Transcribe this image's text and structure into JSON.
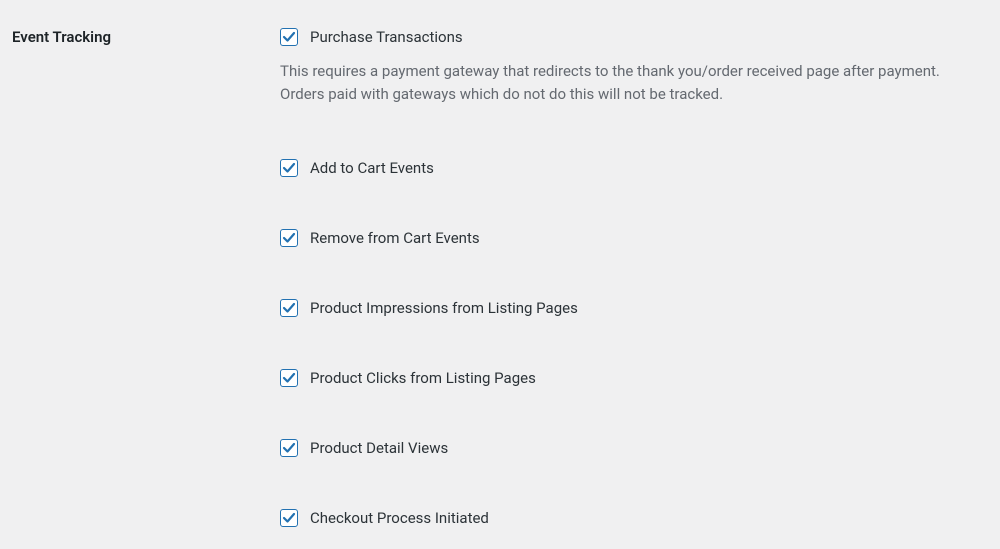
{
  "section": {
    "title": "Event Tracking"
  },
  "options": [
    {
      "key": "purchase-transactions",
      "label": "Purchase Transactions",
      "checked": true,
      "description": "This requires a payment gateway that redirects to the thank you/order received page after payment. Orders paid with gateways which do not do this will not be tracked."
    },
    {
      "key": "add-to-cart",
      "label": "Add to Cart Events",
      "checked": true
    },
    {
      "key": "remove-from-cart",
      "label": "Remove from Cart Events",
      "checked": true
    },
    {
      "key": "product-impressions",
      "label": "Product Impressions from Listing Pages",
      "checked": true
    },
    {
      "key": "product-clicks",
      "label": "Product Clicks from Listing Pages",
      "checked": true
    },
    {
      "key": "product-detail-views",
      "label": "Product Detail Views",
      "checked": true
    },
    {
      "key": "checkout-initiated",
      "label": "Checkout Process Initiated",
      "checked": true
    }
  ]
}
